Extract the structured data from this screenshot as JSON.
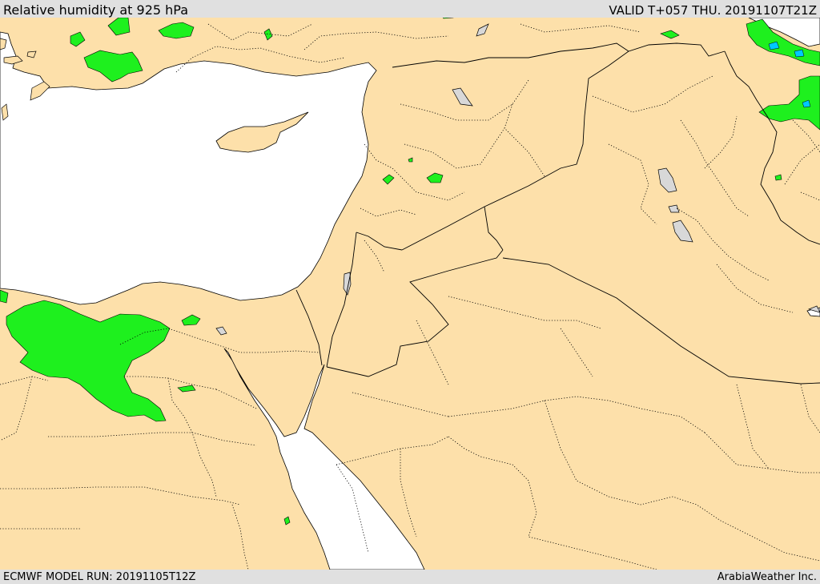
{
  "header": {
    "title": "Relative humidity at 925 hPa",
    "valid": "VALID T+057 THU. 20191107T21Z"
  },
  "footer": {
    "model_run": "ECMWF MODEL RUN: 20191105T12Z",
    "credit": "ArabiaWeather Inc."
  },
  "colors": {
    "land": "#fde0aa",
    "sea": "#ffffff",
    "humidity_fill": "#1ef01e",
    "humidity_high": "#00c8ff",
    "lake": "#d8d8d8",
    "border": "#000000",
    "bar": "#e0e0e0"
  }
}
